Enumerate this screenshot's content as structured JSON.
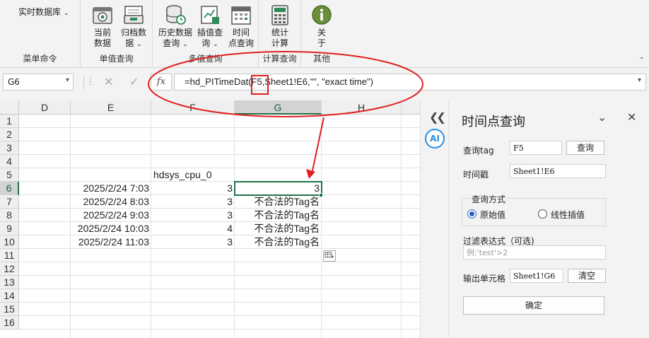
{
  "ribbon": {
    "menu_command": "实时数据库",
    "groups": [
      {
        "label": "菜单命令"
      },
      {
        "label": "单值查询"
      },
      {
        "label": "多值查询"
      },
      {
        "label": "计算查询"
      },
      {
        "label": "其他"
      }
    ],
    "buttons": {
      "current": [
        "当前",
        "数据"
      ],
      "archive": [
        "归档数",
        "据"
      ],
      "history": [
        "历史数据",
        "查询"
      ],
      "interp": [
        "插值查",
        "询"
      ],
      "timepoint": [
        "时间",
        "点查询"
      ],
      "stats": [
        "统计",
        "计算"
      ],
      "about": [
        "关",
        "于"
      ]
    },
    "colors": {
      "accent": "#217346",
      "annotation": "#e02020"
    }
  },
  "formula_bar": {
    "name_box": "G6",
    "fx_label": "fx",
    "formula_text": "=hd_PITimeDat(F5,Sheet1!E6,\"\", \"exact time\")"
  },
  "sheet": {
    "columns": [
      "D",
      "E",
      "F",
      "G",
      "H"
    ],
    "rows": [
      "1",
      "2",
      "3",
      "4",
      "5",
      "6",
      "7",
      "8",
      "9",
      "10",
      "11",
      "12",
      "13",
      "14",
      "15",
      "16"
    ],
    "header_cell": "hdsys_cpu_0",
    "data": [
      {
        "time": "2025/2/24 7:03",
        "value": "3",
        "result": "3"
      },
      {
        "time": "2025/2/24 8:03",
        "value": "3",
        "result": "不合法的Tag名"
      },
      {
        "time": "2025/2/24 9:03",
        "value": "3",
        "result": "不合法的Tag名"
      },
      {
        "time": "2025/2/24 10:03",
        "value": "4",
        "result": "不合法的Tag名"
      },
      {
        "time": "2025/2/24 11:03",
        "value": "3",
        "result": "不合法的Tag名"
      }
    ],
    "active_cell": "G6"
  },
  "panel": {
    "title": "时间点查询",
    "tag_label": "查询tag",
    "tag_value": "F5",
    "query_button": "查询",
    "timestamp_label": "时间戳",
    "timestamp_value": "Sheet1!E6",
    "mode_group_label": "查询方式",
    "mode_options": [
      "原始值",
      "线性插值"
    ],
    "mode_selected": "原始值",
    "filter_label": "过滤表达式（可选)",
    "filter_placeholder": "例:'test'>2",
    "output_label": "输出单元格",
    "output_value": "Sheet1!G6",
    "clear_button": "清空",
    "confirm_button": "确定",
    "ai_badge": "AI"
  }
}
